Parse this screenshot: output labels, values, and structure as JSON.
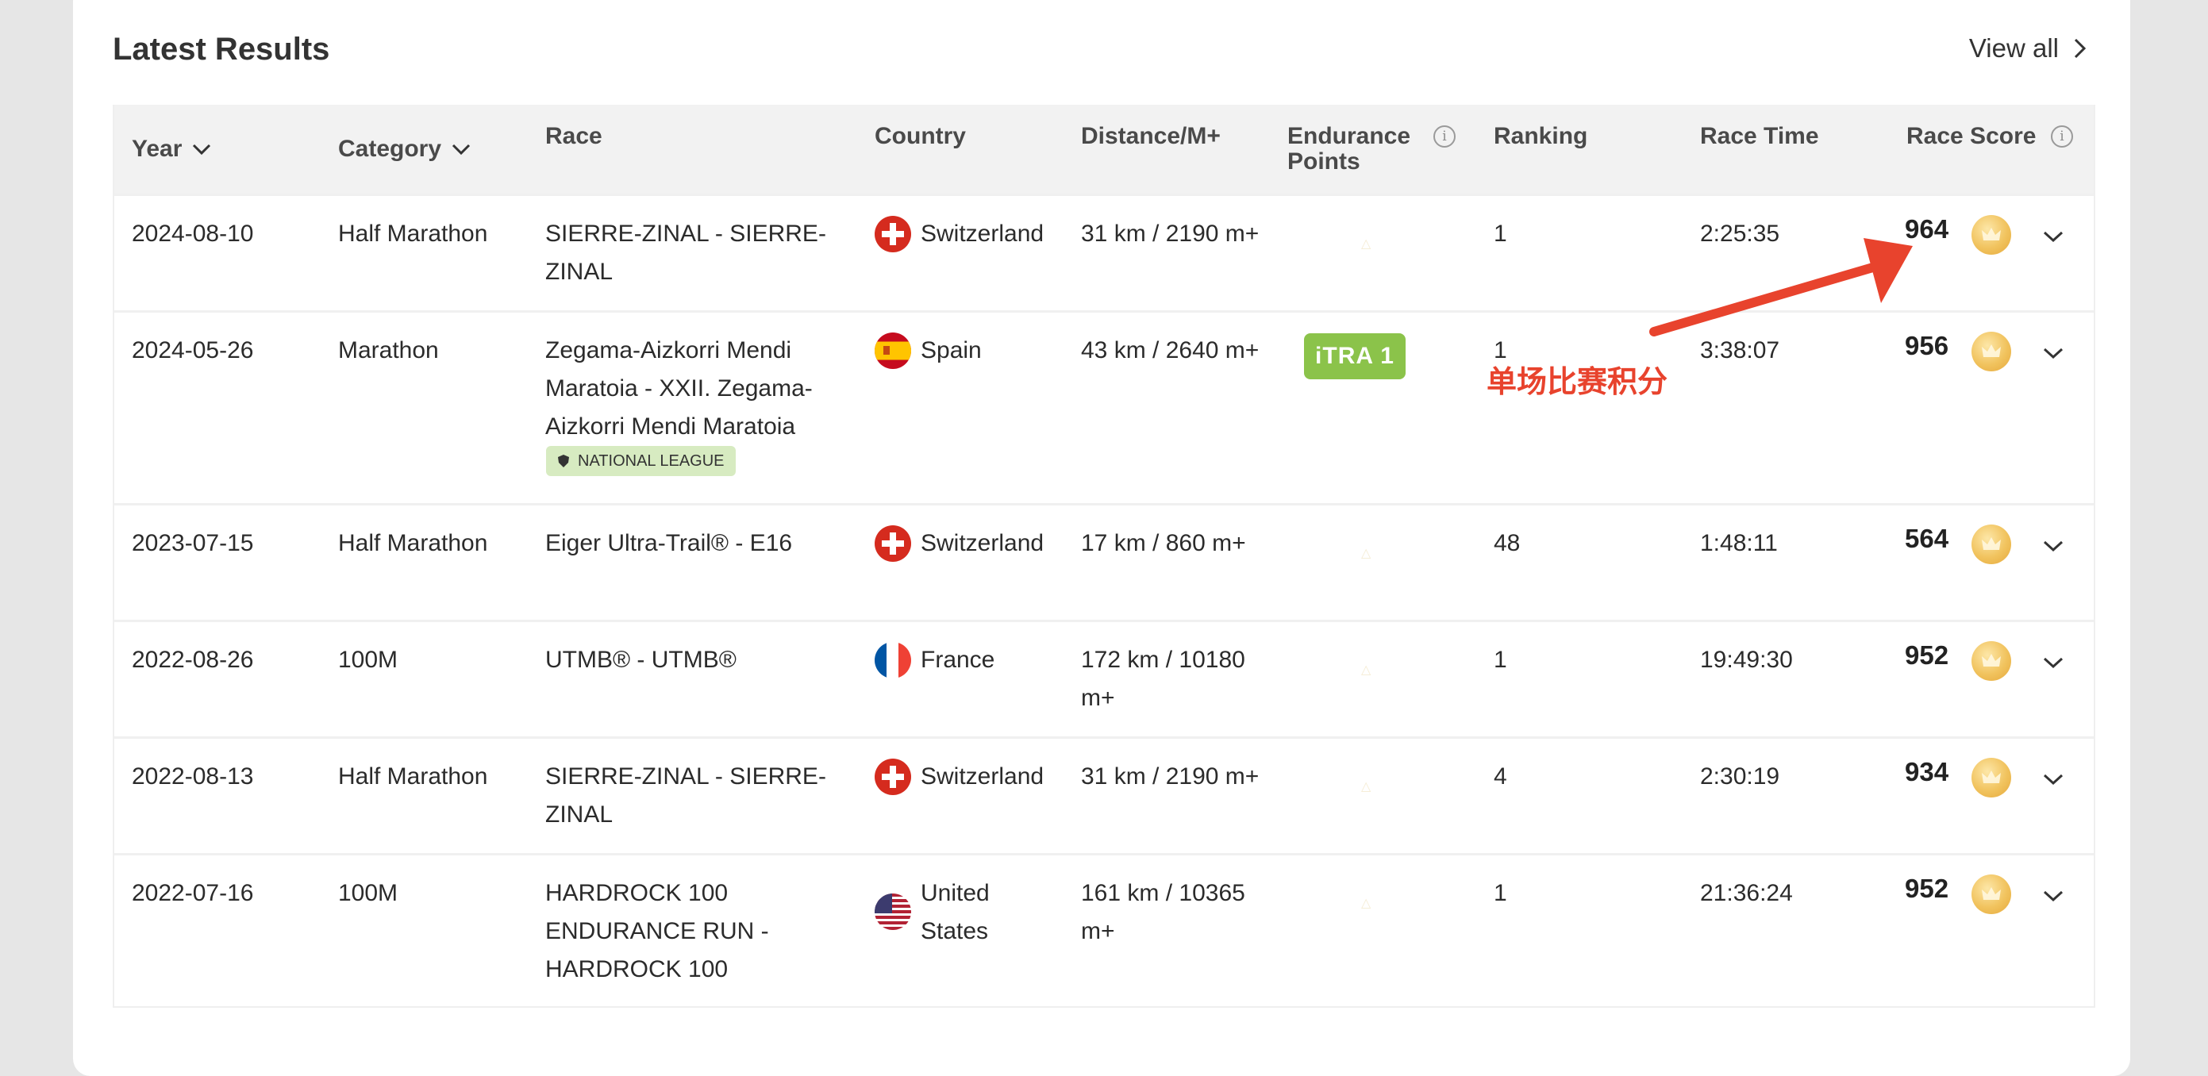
{
  "header": {
    "title": "Latest Results",
    "view_all": "View all"
  },
  "columns": {
    "year": "Year",
    "category": "Category",
    "race": "Race",
    "country": "Country",
    "distance": "Distance/M+",
    "endurance_points": "Endurance Points",
    "ranking": "Ranking",
    "race_time": "Race Time",
    "race_score": "Race Score"
  },
  "rows": [
    {
      "year": "2024-08-10",
      "category": "Half Marathon",
      "race": "SIERRE-ZINAL - SIERRE-ZINAL",
      "country": "Switzerland",
      "flag": "switzerland-flag",
      "distance": "31 km / 2190 m+",
      "ranking": "1",
      "race_time": "2:25:35",
      "score": "964"
    },
    {
      "year": "2024-05-26",
      "category": "Marathon",
      "race": "Zegama-Aizkorri Mendi Maratoia - XXII. Zegama-Aizkorri Mendi Maratoia",
      "badge": "NATIONAL LEAGUE",
      "country": "Spain",
      "flag": "spain-flag",
      "distance": "43 km / 2640 m+",
      "endurance": "iTRA 1",
      "ranking": "1",
      "race_time": "3:38:07",
      "score": "956"
    },
    {
      "year": "2023-07-15",
      "category": "Half Marathon",
      "race": "Eiger Ultra-Trail® - E16",
      "country": "Switzerland",
      "flag": "switzerland-flag",
      "distance": "17 km / 860 m+",
      "ranking": "48",
      "race_time": "1:48:11",
      "score": "564"
    },
    {
      "year": "2022-08-26",
      "category": "100M",
      "race": "UTMB® - UTMB®",
      "country": "France",
      "flag": "france-flag",
      "distance": "172 km / 10180 m+",
      "ranking": "1",
      "race_time": "19:49:30",
      "score": "952"
    },
    {
      "year": "2022-08-13",
      "category": "Half Marathon",
      "race": "SIERRE-ZINAL - SIERRE-ZINAL",
      "country": "Switzerland",
      "flag": "switzerland-flag",
      "distance": "31 km / 2190 m+",
      "ranking": "4",
      "race_time": "2:30:19",
      "score": "934"
    },
    {
      "year": "2022-07-16",
      "category": "100M",
      "race": "HARDROCK 100 ENDURANCE RUN - HARDROCK 100",
      "country": "United States",
      "flag": "usa-flag",
      "distance": "161 km / 10365 m+",
      "ranking": "1",
      "race_time": "21:36:24",
      "score": "952"
    }
  ],
  "annotation": {
    "text": "单场比赛积分",
    "color": "#e8432d"
  },
  "colors": {
    "itra_badge": "#8bc34a",
    "national_league_badge": "#d7ebc1",
    "header_bg": "#f2f2f2",
    "crown_gold": "#f1c35e"
  }
}
